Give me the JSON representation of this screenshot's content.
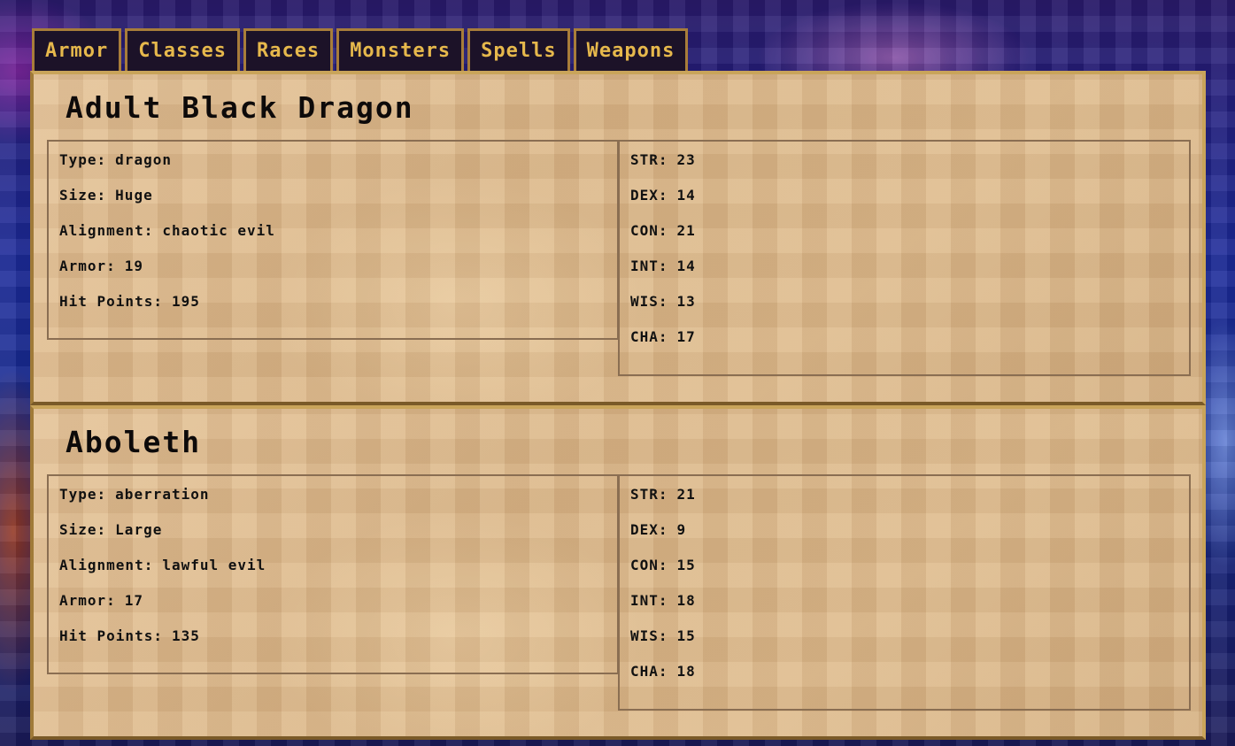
{
  "tabs": [
    "Armor",
    "Classes",
    "Races",
    "Monsters",
    "Spells",
    "Weapons"
  ],
  "monsters": [
    {
      "name": "Adult Black Dragon",
      "info": [
        {
          "label": "Type:",
          "value": "dragon"
        },
        {
          "label": "Size:",
          "value": "Huge"
        },
        {
          "label": "Alignment:",
          "value": "chaotic evil"
        },
        {
          "label": "Armor:",
          "value": "19"
        },
        {
          "label": "Hit Points:",
          "value": "195"
        }
      ],
      "stats": [
        {
          "label": "STR:",
          "value": "23"
        },
        {
          "label": "DEX:",
          "value": "14"
        },
        {
          "label": "CON:",
          "value": "21"
        },
        {
          "label": "INT:",
          "value": "14"
        },
        {
          "label": "WIS:",
          "value": "13"
        },
        {
          "label": "CHA:",
          "value": "17"
        }
      ]
    },
    {
      "name": "Aboleth",
      "info": [
        {
          "label": "Type:",
          "value": "aberration"
        },
        {
          "label": "Size:",
          "value": "Large"
        },
        {
          "label": "Alignment:",
          "value": "lawful evil"
        },
        {
          "label": "Armor:",
          "value": "17"
        },
        {
          "label": "Hit Points:",
          "value": "135"
        }
      ],
      "stats": [
        {
          "label": "STR:",
          "value": "21"
        },
        {
          "label": "DEX:",
          "value": "9"
        },
        {
          "label": "CON:",
          "value": "15"
        },
        {
          "label": "INT:",
          "value": "18"
        },
        {
          "label": "WIS:",
          "value": "15"
        },
        {
          "label": "CHA:",
          "value": "18"
        }
      ]
    }
  ]
}
